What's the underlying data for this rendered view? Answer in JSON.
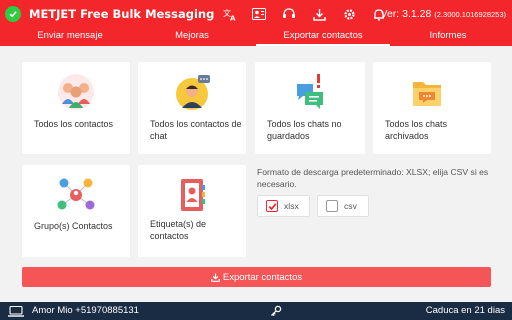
{
  "header": {
    "title": "METJET Free Bulk Messaging",
    "version": "Ver: 3.1.28",
    "version_build": "(2.3000.1016928253)",
    "icons": [
      "translate-icon",
      "contacts-icon",
      "support-icon",
      "download-icon",
      "settings-icon",
      "bell-icon"
    ],
    "bg_color": "#f3262b"
  },
  "tabs": [
    {
      "label": "Enviar mensaje"
    },
    {
      "label": "Mejoras"
    },
    {
      "label": "Exportar contactos",
      "active": true
    },
    {
      "label": "Informes"
    }
  ],
  "cards": [
    {
      "label": "Todos los contactos"
    },
    {
      "label": "Todos los contactos de chat"
    },
    {
      "label": "Todos los chats no guardados"
    },
    {
      "label": "Todos los chats archivados"
    },
    {
      "label": "Grupo(s) Contactos"
    },
    {
      "label": "Etiqueta(s) de contactos"
    }
  ],
  "format": {
    "description": "Formato de descarga predeterminado: XLSX; elija CSV si es necesario.",
    "options": [
      {
        "label": "xlsx",
        "checked": true
      },
      {
        "label": "csv",
        "checked": false
      }
    ]
  },
  "export_button": {
    "label": "Exportar contactos"
  },
  "footer": {
    "user": "Amor Mio +51970885131",
    "expiry": "Caduca en 21 dias",
    "bg_color": "#1a2b44"
  }
}
